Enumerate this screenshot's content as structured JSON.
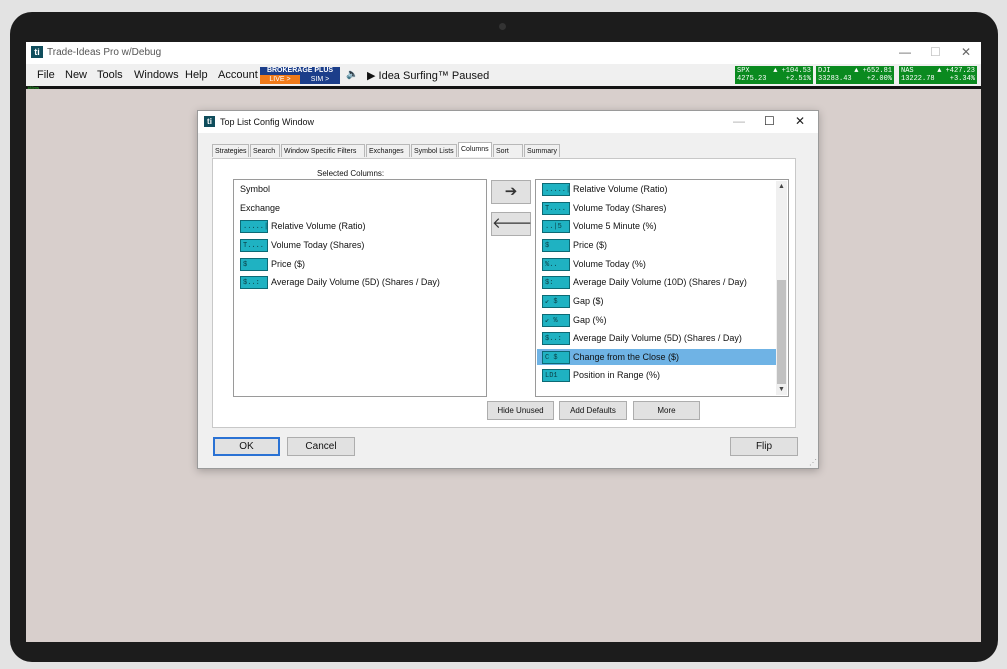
{
  "app": {
    "logo": "ti",
    "title": "Trade-Ideas Pro w/Debug",
    "menu": [
      "File",
      "New",
      "Tools",
      "Windows",
      "Help",
      "Account"
    ],
    "brokerage": {
      "label": "BROKERAGE PLUS",
      "live": "LIVE >",
      "sim": "SIM >"
    },
    "idea_surfing": "Idea Surfing™ Paused",
    "tickers": [
      {
        "symbol": "SPX",
        "price": "4275.23",
        "change": "▲ +104.53",
        "pct": "+2.51%"
      },
      {
        "symbol": "DJI",
        "price": "33283.43",
        "change": "▲ +652.81",
        "pct": "+2.00%"
      },
      {
        "symbol": "NAS",
        "price": "13222.78",
        "change": "▲ +427.23",
        "pct": "+3.34%"
      }
    ],
    "status_left": "185ms",
    "colors": {
      "ticker_green": "#0a8a1f",
      "brokerage_blue": "#1c3e8a",
      "live_orange": "#f07a1a"
    }
  },
  "dialog": {
    "title": "Top List Config Window",
    "tabs": [
      "Strategies",
      "Search",
      "Window Specific Filters",
      "Exchanges",
      "Symbol Lists",
      "Columns",
      "Sort",
      "Summary"
    ],
    "active_tab": "Columns",
    "selected_columns_label": "Selected Columns:",
    "selected_columns": [
      {
        "icon": "",
        "label": "Symbol"
      },
      {
        "icon": "",
        "label": "Exchange"
      },
      {
        "icon": ".....|",
        "label": "Relative Volume (Ratio)"
      },
      {
        "icon": "T....",
        "label": "Volume Today (Shares)"
      },
      {
        "icon": " $",
        "label": "Price ($)"
      },
      {
        "icon": "$..:",
        "label": "Average Daily Volume (5D) (Shares / Day)"
      }
    ],
    "available_columns": [
      {
        "icon": ".....|",
        "label": "Relative Volume (Ratio)"
      },
      {
        "icon": "T....",
        "label": "Volume Today (Shares)"
      },
      {
        "icon": "..|5",
        "label": "Volume 5 Minute (%)"
      },
      {
        "icon": " $",
        "label": "Price ($)"
      },
      {
        "icon": "%..",
        "label": "Volume Today (%)"
      },
      {
        "icon": "$:",
        "label": "Average Daily Volume (10D) (Shares / Day)"
      },
      {
        "icon": "↙ $",
        "label": "Gap ($)"
      },
      {
        "icon": "↙ %",
        "label": "Gap (%)"
      },
      {
        "icon": "$..:",
        "label": "Average Daily Volume (5D) (Shares / Day)"
      },
      {
        "icon": "C $",
        "label": "Change from the Close ($)",
        "selected": true
      },
      {
        "icon": "LD1",
        "label": "Position in Range (%)"
      }
    ],
    "buttons": {
      "hide_unused": "Hide Unused",
      "add_defaults": "Add Defaults",
      "more": "More",
      "ok": "OK",
      "cancel": "Cancel",
      "flip": "Flip"
    },
    "colors": {
      "selected_row": "#6fb3e5",
      "column_icon": "#1fb2c2"
    }
  }
}
